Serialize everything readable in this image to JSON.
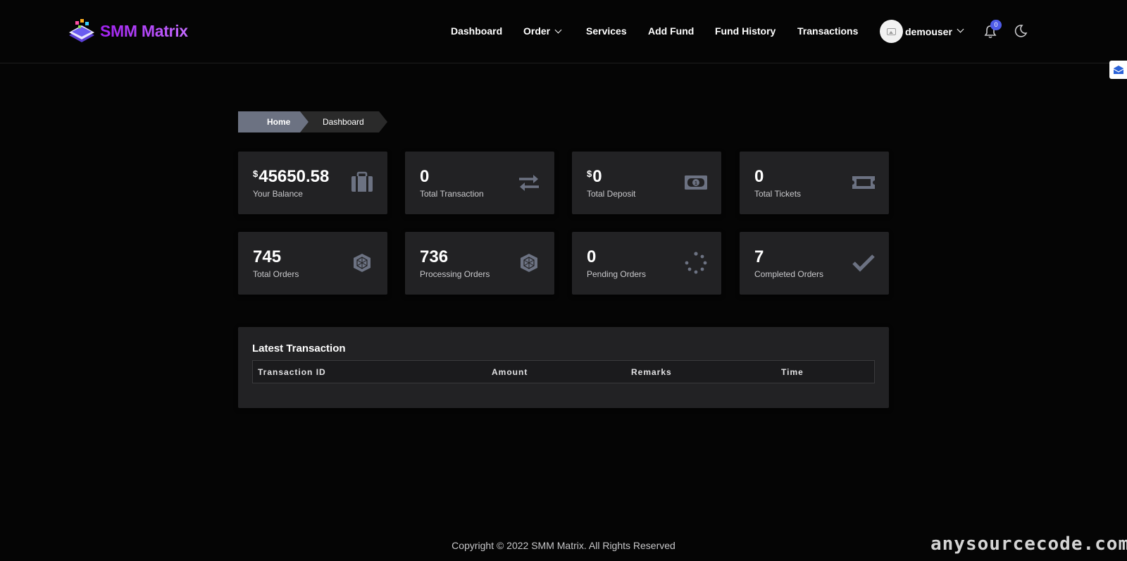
{
  "brand": {
    "name": "SMM Matrix",
    "accent": "#a020f0"
  },
  "nav": {
    "dashboard": "Dashboard",
    "order": "Order",
    "services": "Services",
    "add_fund": "Add Fund",
    "fund_history": "Fund History",
    "transactions": "Transactions"
  },
  "user": {
    "name": "demouser",
    "notification_count": "0"
  },
  "breadcrumb": {
    "home": "Home",
    "current": "Dashboard"
  },
  "stats": [
    {
      "currency": "$",
      "value": "45650.58",
      "label": "Your Balance",
      "icon": "briefcase-icon"
    },
    {
      "currency": "",
      "value": "0",
      "label": "Total Transaction",
      "icon": "exchange-icon"
    },
    {
      "currency": "$",
      "value": "0",
      "label": "Total Deposit",
      "icon": "money-bill-icon"
    },
    {
      "currency": "",
      "value": "0",
      "label": "Total Tickets",
      "icon": "ticket-icon"
    },
    {
      "currency": "",
      "value": "745",
      "label": "Total Orders",
      "icon": "cube-icon"
    },
    {
      "currency": "",
      "value": "736",
      "label": "Processing Orders",
      "icon": "cube-icon"
    },
    {
      "currency": "",
      "value": "0",
      "label": "Pending Orders",
      "icon": "spinner-icon"
    },
    {
      "currency": "",
      "value": "7",
      "label": "Completed Orders",
      "icon": "check-icon"
    }
  ],
  "latest_transaction": {
    "title": "Latest Transaction",
    "columns": [
      "Transaction ID",
      "Amount",
      "Remarks",
      "Time"
    ],
    "rows": []
  },
  "footer": {
    "copyright": "Copyright © 2022 SMM Matrix. All Rights Reserved"
  },
  "watermark": "anysourcecode.com"
}
